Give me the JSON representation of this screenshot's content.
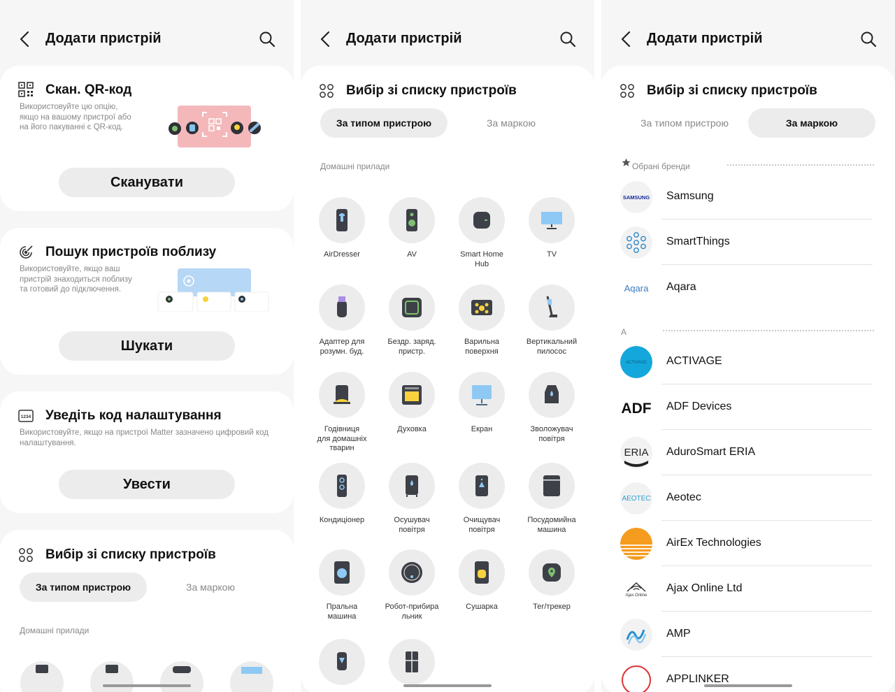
{
  "appbar": {
    "title": "Додати пристрій"
  },
  "qr": {
    "title": "Скан. QR-код",
    "desc_lines": [
      "Використовуйте цю опцію,",
      "якщо на вашому пристрої або",
      "на його пакуванні є QR-код."
    ],
    "button": "Сканувати"
  },
  "nearby": {
    "title": "Пошук пристроїв поблизу",
    "desc_lines": [
      "Використовуйте, якщо ваш",
      "пристрій знаходиться поблизу",
      "та готовий до підключення."
    ],
    "button": "Шукати"
  },
  "code": {
    "title": "Уведіть код налаштування",
    "desc_lines": [
      "Використовуйте, якщо на пристрої Matter зазначено цифровий код",
      "налаштування."
    ],
    "button": "Увести"
  },
  "list_section": {
    "title": "Вибір зі списку пристроїв",
    "tab_type": "За типом пристрою",
    "tab_brand": "За маркою",
    "category_label": "Домашні прилади"
  },
  "devices": [
    {
      "label1": "AirDresser",
      "label2": "",
      "label3": "",
      "icon": "airdresser-icon"
    },
    {
      "label1": "AV",
      "label2": "",
      "label3": "",
      "icon": "av-speaker-icon"
    },
    {
      "label1": "Smart Home",
      "label2": "Hub",
      "label3": "",
      "icon": "hub-icon"
    },
    {
      "label1": "TV",
      "label2": "",
      "label3": "",
      "icon": "tv-icon"
    },
    {
      "label1": "Адаптер для",
      "label2": "розумн. буд.",
      "label3": "",
      "icon": "adapter-icon"
    },
    {
      "label1": "Бездр. заряд.",
      "label2": "пристр.",
      "label3": "",
      "icon": "wireless-charger-icon"
    },
    {
      "label1": "Варильна",
      "label2": "поверхня",
      "label3": "",
      "icon": "cooktop-icon"
    },
    {
      "label1": "Вертикальний",
      "label2": "пилосос",
      "label3": "",
      "icon": "stick-vacuum-icon"
    },
    {
      "label1": "Годівниця",
      "label2": "для домашніх",
      "label3": "тварин",
      "icon": "pet-feeder-icon"
    },
    {
      "label1": "Духовка",
      "label2": "",
      "label3": "",
      "icon": "oven-icon"
    },
    {
      "label1": "Екран",
      "label2": "",
      "label3": "",
      "icon": "screen-icon"
    },
    {
      "label1": "Зволожувач",
      "label2": "повітря",
      "label3": "",
      "icon": "humidifier-icon"
    },
    {
      "label1": "Кондиціонер",
      "label2": "",
      "label3": "",
      "icon": "air-conditioner-icon"
    },
    {
      "label1": "Осушувач",
      "label2": "повітря",
      "label3": "",
      "icon": "dehumidifier-icon"
    },
    {
      "label1": "Очищувач",
      "label2": "повітря",
      "label3": "",
      "icon": "air-purifier-icon"
    },
    {
      "label1": "Посудомийна",
      "label2": "машина",
      "label3": "",
      "icon": "dishwasher-icon"
    },
    {
      "label1": "Пральна",
      "label2": "машина",
      "label3": "",
      "icon": "washer-icon"
    },
    {
      "label1": "Робот-прибира",
      "label2": "льник",
      "label3": "",
      "icon": "robot-vacuum-icon"
    },
    {
      "label1": "Сушарка",
      "label2": "",
      "label3": "",
      "icon": "dryer-icon"
    },
    {
      "label1": "Тег/трекер",
      "label2": "",
      "label3": "",
      "icon": "tag-tracker-icon"
    }
  ],
  "brands": {
    "favorites_label": "Обрані бренди",
    "letter_a": "A",
    "favorites": [
      {
        "name": "Samsung",
        "logo": "samsung-logo",
        "logo_text": "SAMSUNG"
      },
      {
        "name": "SmartThings",
        "logo": "smartthings-logo",
        "logo_text": ""
      },
      {
        "name": "Aqara",
        "logo": "aqara-logo",
        "logo_text": "Aqara"
      }
    ],
    "a_list": [
      {
        "name": "ACTIVAGE",
        "logo": "activage-logo",
        "logo_text": "ACTIVAGE"
      },
      {
        "name": "ADF Devices",
        "logo": "adf-logo",
        "logo_text": "ADF"
      },
      {
        "name": "AduroSmart ERIA",
        "logo": "eria-logo",
        "logo_text": "ERIA"
      },
      {
        "name": "Aeotec",
        "logo": "aeotec-logo",
        "logo_text": "AEOTEC"
      },
      {
        "name": "AirEx Technologies",
        "logo": "airex-logo",
        "logo_text": ""
      },
      {
        "name": "Ajax Online Ltd",
        "logo": "ajax-logo",
        "logo_text": "Ajax Online"
      },
      {
        "name": "AMP",
        "logo": "amp-logo",
        "logo_text": ""
      }
    ],
    "cut_off_text": "APPLINKER"
  },
  "colors": {
    "panel_bg": "#f6f6f6",
    "card_bg": "#ffffff",
    "pill_bg": "#ececec",
    "icon_dark": "#3d4047",
    "accent_blue": "#1e88e5"
  }
}
